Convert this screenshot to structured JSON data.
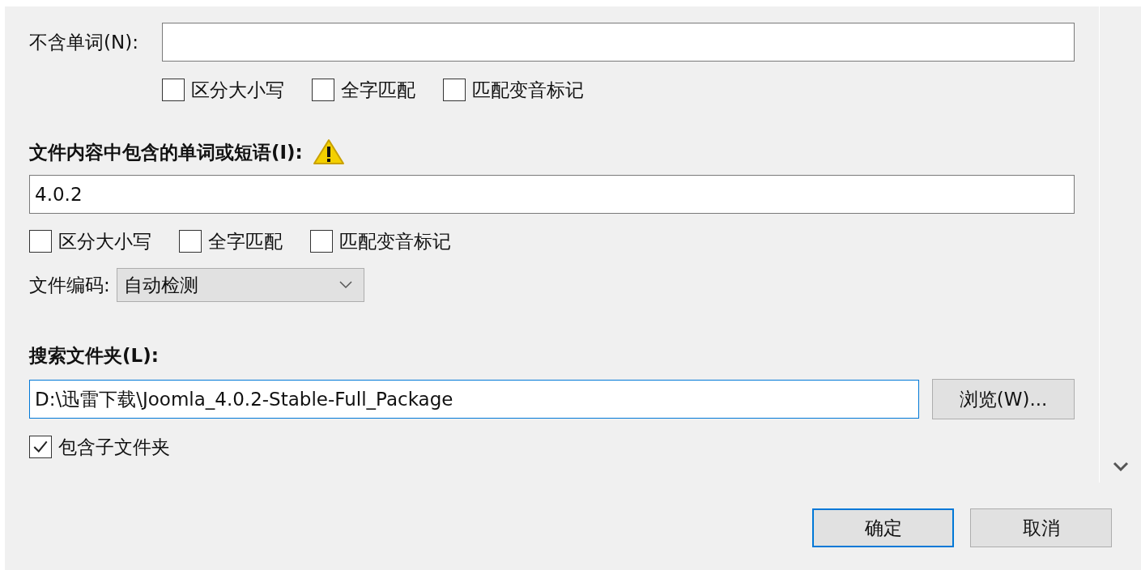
{
  "exclude_words": {
    "label": "不含单词(N):",
    "options": [
      {
        "label": "区分大小写",
        "checked": false
      },
      {
        "label": "全字匹配",
        "checked": false
      },
      {
        "label": "匹配变音标记",
        "checked": false
      }
    ]
  },
  "include_words": {
    "label": "文件内容中包含的单词或短语(I):",
    "warning": true,
    "value": "4.0.2",
    "options": [
      {
        "label": "区分大小写",
        "checked": false
      },
      {
        "label": "全字匹配",
        "checked": false
      },
      {
        "label": "匹配变音标记",
        "checked": false
      }
    ]
  },
  "encoding": {
    "label": "文件编码:",
    "value": "自动检测"
  },
  "folder": {
    "label": "搜索文件夹(L):",
    "value": "D:\\迅雷下载\\Joomla_4.0.2-Stable-Full_Package",
    "focused": true,
    "browse_button": "浏览(W)...",
    "include_subfolders": {
      "label": "包含子文件夹",
      "checked": true
    }
  },
  "buttons": [
    {
      "label": "确定",
      "default": true
    },
    {
      "label": "取消",
      "default": false
    }
  ]
}
